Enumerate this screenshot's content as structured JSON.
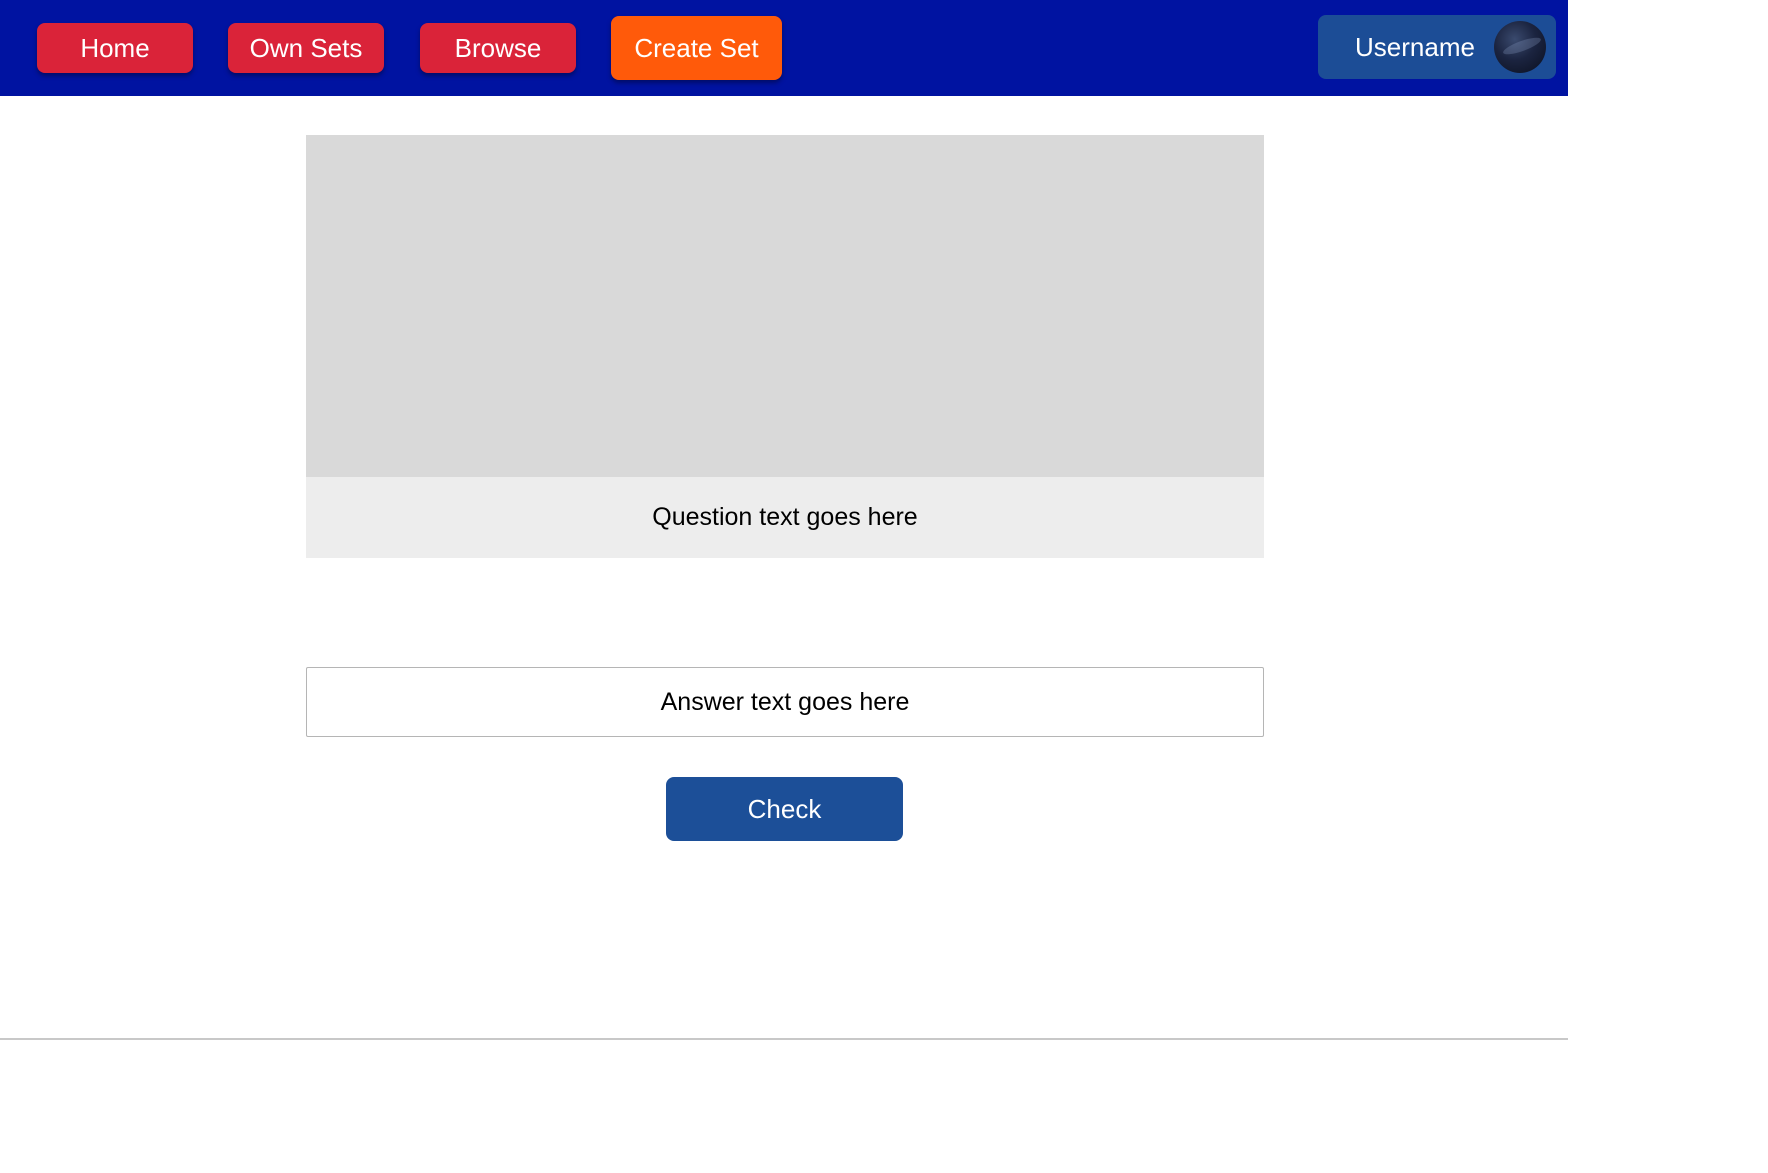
{
  "nav": {
    "home_label": "Home",
    "own_sets_label": "Own Sets",
    "browse_label": "Browse",
    "create_set_label": "Create Set"
  },
  "user": {
    "username": "Username",
    "avatar_icon": "profile-avatar"
  },
  "card": {
    "question_text": "Question text goes here"
  },
  "answer": {
    "placeholder": "Answer text goes here",
    "value": ""
  },
  "check_label": "Check",
  "colors": {
    "navbar": "#0013a1",
    "nav_button": "#da2339",
    "create_button": "#ff5a0a",
    "user_box": "#1c4d96",
    "check_button": "#1c4f98",
    "image_placeholder": "#d9d9d9",
    "question_area": "#ededed"
  }
}
